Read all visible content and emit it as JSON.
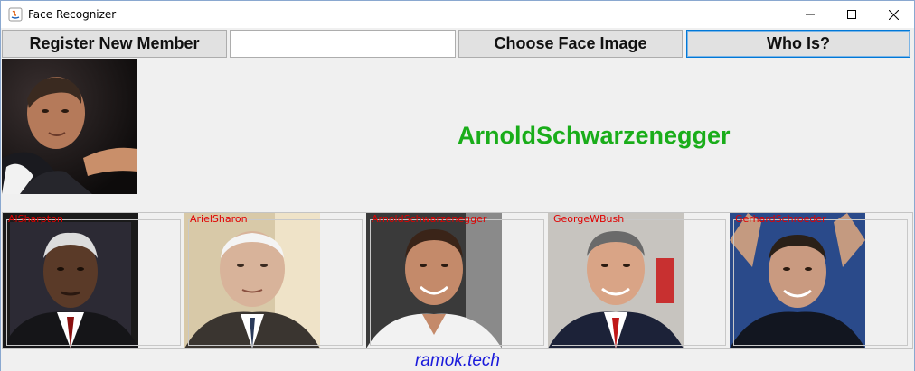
{
  "window": {
    "title": "Face Recognizer"
  },
  "toolbar": {
    "register_label": "Register New Member",
    "name_value": "",
    "choose_label": "Choose Face Image",
    "whois_label": "Who Is?"
  },
  "result": {
    "name": "ArnoldSchwarzenegger",
    "color": "#1aad1a"
  },
  "gallery": {
    "members": [
      {
        "label": "AlSharpton"
      },
      {
        "label": "ArielSharon"
      },
      {
        "label": "ArnoldSchwarzenegger"
      },
      {
        "label": "GeorgeWBush"
      },
      {
        "label": "GerhardSchroeder"
      }
    ],
    "label_color": "#e00000"
  },
  "footer": {
    "text": "ramok.tech",
    "color": "#1a1adb"
  }
}
